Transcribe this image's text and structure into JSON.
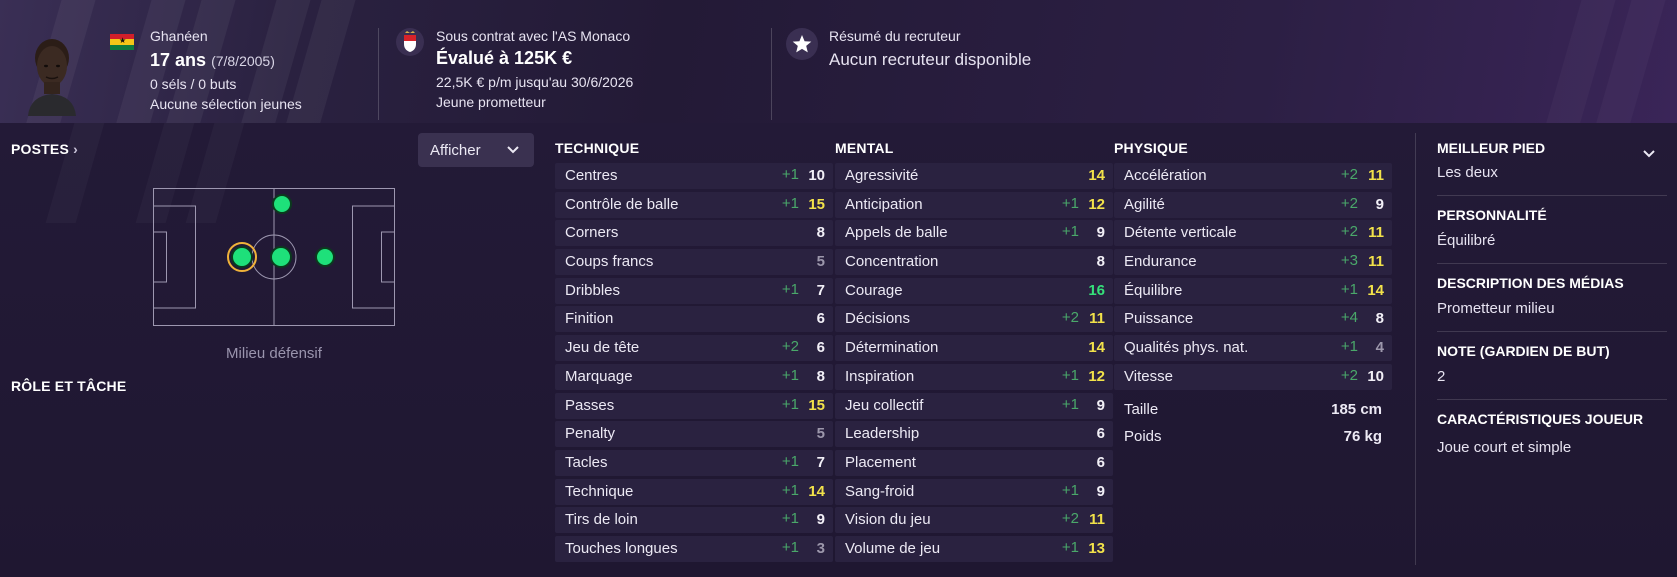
{
  "header": {
    "nationality": "Ghanéen",
    "age": "17 ans",
    "birthdate": "(7/8/2005)",
    "caps_goals": "0 séls / 0 buts",
    "youth_caps": "Aucune sélection jeunes",
    "contract_label": "Sous contrat avec l'AS Monaco",
    "value": "Évalué à 125K €",
    "wage": "22,5K € p/m jusqu'au 30/6/2026",
    "status": "Jeune prometteur",
    "scout_label": "Résumé du recruteur",
    "scout_value": "Aucun recruteur disponible"
  },
  "left": {
    "positions_title": "POSTES",
    "afficher_label": "Afficher",
    "position_label": "Milieu défensif",
    "role_title": "RÔLE ET TÂCHE"
  },
  "colors": {
    "delta": "#4aa86a",
    "val_normal": "#f2f0f7",
    "val_dim": "#9c97ab",
    "val_yellow": "#f2e24a",
    "val_green": "#35e07a",
    "position_dot": "#1ee07a",
    "ring": "#f0b23a"
  },
  "attributes": {
    "technique": {
      "title": "TECHNIQUE",
      "rows": [
        {
          "name": "Centres",
          "delta": "+1",
          "value": "10",
          "tone": "normal"
        },
        {
          "name": "Contrôle de balle",
          "delta": "+1",
          "value": "15",
          "tone": "yellow"
        },
        {
          "name": "Corners",
          "delta": "",
          "value": "8",
          "tone": "normal"
        },
        {
          "name": "Coups francs",
          "delta": "",
          "value": "5",
          "tone": "dim"
        },
        {
          "name": "Dribbles",
          "delta": "+1",
          "value": "7",
          "tone": "normal"
        },
        {
          "name": "Finition",
          "delta": "",
          "value": "6",
          "tone": "normal"
        },
        {
          "name": "Jeu de tête",
          "delta": "+2",
          "value": "6",
          "tone": "normal"
        },
        {
          "name": "Marquage",
          "delta": "+1",
          "value": "8",
          "tone": "normal"
        },
        {
          "name": "Passes",
          "delta": "+1",
          "value": "15",
          "tone": "yellow"
        },
        {
          "name": "Penalty",
          "delta": "",
          "value": "5",
          "tone": "dim"
        },
        {
          "name": "Tacles",
          "delta": "+1",
          "value": "7",
          "tone": "normal"
        },
        {
          "name": "Technique",
          "delta": "+1",
          "value": "14",
          "tone": "yellow"
        },
        {
          "name": "Tirs de loin",
          "delta": "+1",
          "value": "9",
          "tone": "normal"
        },
        {
          "name": "Touches longues",
          "delta": "+1",
          "value": "3",
          "tone": "dim"
        }
      ]
    },
    "mental": {
      "title": "MENTAL",
      "rows": [
        {
          "name": "Agressivité",
          "delta": "",
          "value": "14",
          "tone": "yellow"
        },
        {
          "name": "Anticipation",
          "delta": "+1",
          "value": "12",
          "tone": "yellow"
        },
        {
          "name": "Appels de balle",
          "delta": "+1",
          "value": "9",
          "tone": "normal"
        },
        {
          "name": "Concentration",
          "delta": "",
          "value": "8",
          "tone": "normal"
        },
        {
          "name": "Courage",
          "delta": "",
          "value": "16",
          "tone": "green"
        },
        {
          "name": "Décisions",
          "delta": "+2",
          "value": "11",
          "tone": "yellow"
        },
        {
          "name": "Détermination",
          "delta": "",
          "value": "14",
          "tone": "yellow"
        },
        {
          "name": "Inspiration",
          "delta": "+1",
          "value": "12",
          "tone": "yellow"
        },
        {
          "name": "Jeu collectif",
          "delta": "+1",
          "value": "9",
          "tone": "normal"
        },
        {
          "name": "Leadership",
          "delta": "",
          "value": "6",
          "tone": "normal"
        },
        {
          "name": "Placement",
          "delta": "",
          "value": "6",
          "tone": "normal"
        },
        {
          "name": "Sang-froid",
          "delta": "+1",
          "value": "9",
          "tone": "normal"
        },
        {
          "name": "Vision du jeu",
          "delta": "+2",
          "value": "11",
          "tone": "yellow"
        },
        {
          "name": "Volume de jeu",
          "delta": "+1",
          "value": "13",
          "tone": "yellow"
        }
      ]
    },
    "physique": {
      "title": "PHYSIQUE",
      "rows": [
        {
          "name": "Accélération",
          "delta": "+2",
          "value": "11",
          "tone": "yellow"
        },
        {
          "name": "Agilité",
          "delta": "+2",
          "value": "9",
          "tone": "normal"
        },
        {
          "name": "Détente verticale",
          "delta": "+2",
          "value": "11",
          "tone": "yellow"
        },
        {
          "name": "Endurance",
          "delta": "+3",
          "value": "11",
          "tone": "yellow"
        },
        {
          "name": "Équilibre",
          "delta": "+1",
          "value": "14",
          "tone": "yellow"
        },
        {
          "name": "Puissance",
          "delta": "+4",
          "value": "8",
          "tone": "normal"
        },
        {
          "name": "Qualités phys. nat.",
          "delta": "+1",
          "value": "4",
          "tone": "dim"
        },
        {
          "name": "Vitesse",
          "delta": "+2",
          "value": "10",
          "tone": "normal"
        }
      ],
      "height_label": "Taille",
      "height_value": "185 cm",
      "weight_label": "Poids",
      "weight_value": "76 kg"
    }
  },
  "right_panel": {
    "best_foot_title": "MEILLEUR PIED",
    "best_foot_value": "Les deux",
    "personality_title": "PERSONNALITÉ",
    "personality_value": "Équilibré",
    "media_title": "DESCRIPTION DES MÉDIAS",
    "media_value": "Prometteur milieu",
    "gk_title": "NOTE (GARDIEN DE BUT)",
    "gk_value": "2",
    "traits_title": "CARACTÉRISTIQUES JOUEUR",
    "traits_value": "Joue court et simple"
  }
}
